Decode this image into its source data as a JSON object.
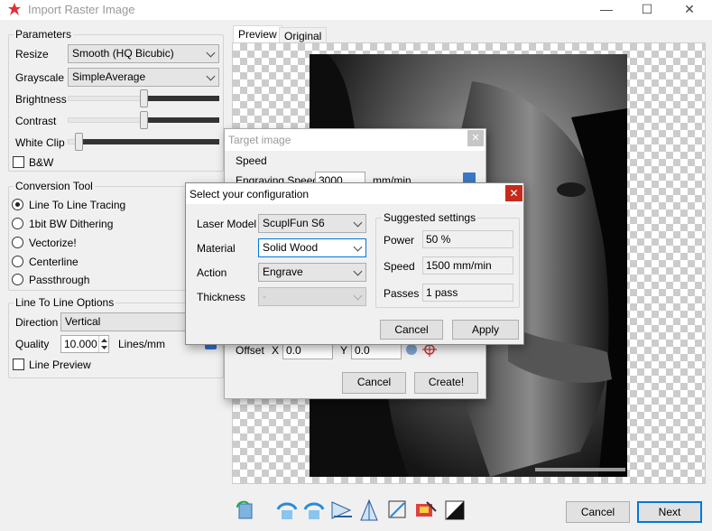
{
  "window": {
    "title": "Import Raster Image",
    "minimize": "—",
    "maximize": "☐",
    "close": "✕"
  },
  "parameters": {
    "group_label": "Parameters",
    "resize_label": "Resize",
    "resize_value": "Smooth (HQ Bicubic)",
    "grayscale_label": "Grayscale",
    "grayscale_value": "SimpleAverage",
    "brightness_label": "Brightness",
    "brightness_level": 0.5,
    "contrast_label": "Contrast",
    "contrast_level": 0.5,
    "whiteclip_label": "White Clip",
    "whiteclip_level": 0.05,
    "bw_label": "B&W",
    "bw_checked": false
  },
  "conversion": {
    "group_label": "Conversion Tool",
    "options": [
      "Line To Line Tracing",
      "1bit BW Dithering",
      "Vectorize!",
      "Centerline",
      "Passthrough"
    ],
    "selected": 0
  },
  "line_options": {
    "group_label": "Line To Line Options",
    "direction_label": "Direction",
    "direction_value": "Vertical",
    "quality_label": "Quality",
    "quality_value": "10.000",
    "quality_unit": "Lines/mm",
    "line_preview_label": "Line Preview",
    "line_preview_checked": false
  },
  "tabs": [
    "Preview",
    "Original"
  ],
  "target_dialog": {
    "title": "Target image",
    "speed_group": "Speed",
    "engraving_speed_label": "Engraving Speed",
    "engraving_speed_value": "3000",
    "speed_unit": "mm/min",
    "offset_label": "Offset",
    "x_label": "X",
    "x_value": "0.0",
    "y_label": "Y",
    "y_value": "0.0",
    "cancel": "Cancel",
    "create": "Create!"
  },
  "config_dialog": {
    "title": "Select your configuration",
    "laser_model_label": "Laser Model",
    "laser_model_value": "ScuplFun S6",
    "material_label": "Material",
    "material_value": "Solid Wood",
    "action_label": "Action",
    "action_value": "Engrave",
    "thickness_label": "Thickness",
    "thickness_value": "-",
    "suggested_group": "Suggested settings",
    "power_label": "Power",
    "power_value": "50 %",
    "speed_label": "Speed",
    "speed_value": "1500 mm/min",
    "passes_label": "Passes",
    "passes_value": "1 pass",
    "cancel": "Cancel",
    "apply": "Apply"
  },
  "footer": {
    "cancel": "Cancel",
    "next": "Next",
    "tools": [
      "rotate-left-icon",
      "flip-horizontal-icon",
      "flip-vertical-icon",
      "mirror-icon",
      "crop-icon",
      "resize-icon",
      "image-edit-icon",
      "invert-icon"
    ]
  },
  "colors": {
    "accent": "#0078d7",
    "close_red": "#c42b1c"
  }
}
